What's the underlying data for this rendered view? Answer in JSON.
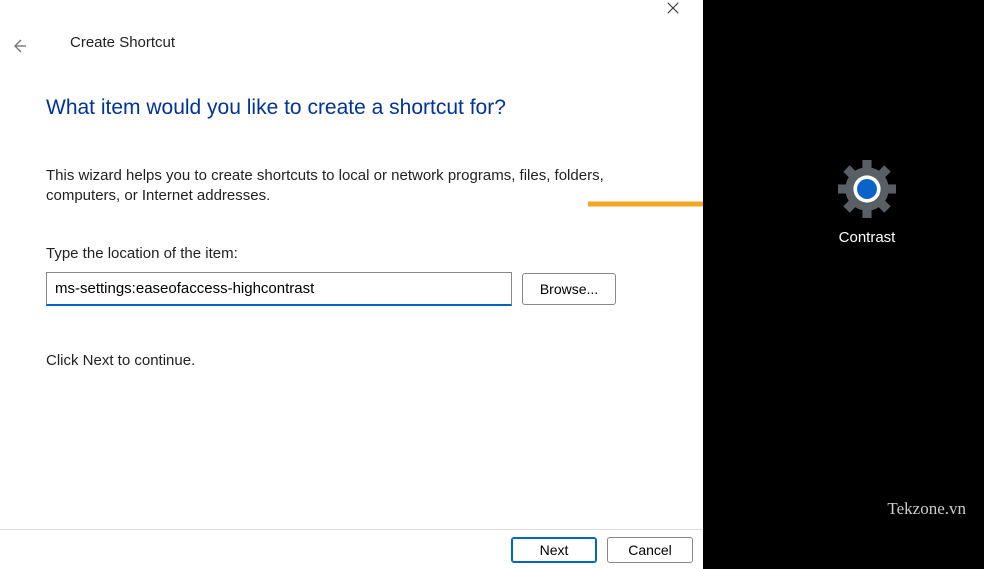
{
  "dialog": {
    "title": "Create Shortcut",
    "headline": "What item would you like to create a shortcut for?",
    "helptext": "This wizard helps you to create shortcuts to local or network programs, files, folders, computers, or Internet addresses.",
    "location_label": "Type the location of the item:",
    "location_value": "ms-settings:easeofaccess-highcontrast",
    "browse_label": "Browse...",
    "continue_text": "Click Next to continue.",
    "next_label": "Next",
    "cancel_label": "Cancel"
  },
  "desktop": {
    "shortcut_label": "Contrast"
  },
  "watermark": "Tekzone.vn"
}
